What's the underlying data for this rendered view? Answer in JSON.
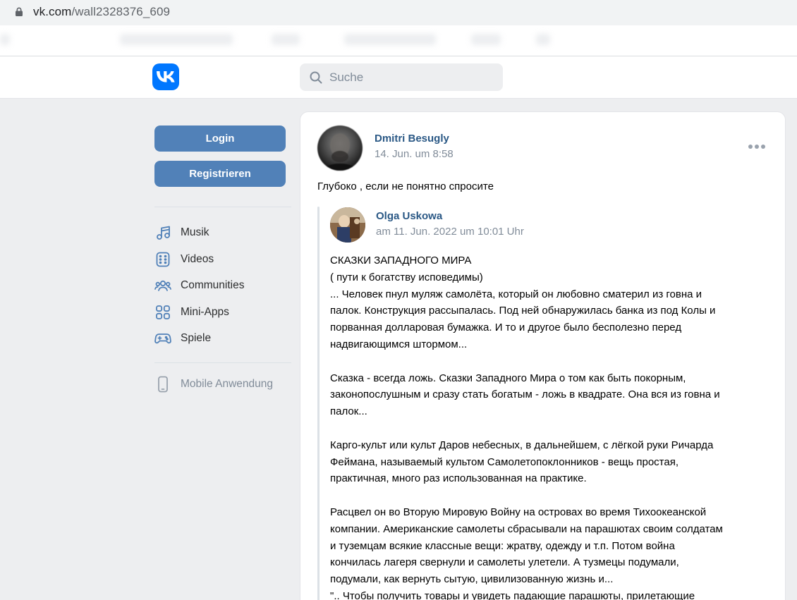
{
  "browser": {
    "url_host": "vk.com",
    "url_path": "/wall2328376_609"
  },
  "header": {
    "search_placeholder": "Suche"
  },
  "sidebar": {
    "login_label": "Login",
    "register_label": "Registrieren",
    "items": [
      {
        "label": "Musik",
        "icon": "music-icon"
      },
      {
        "label": "Videos",
        "icon": "videos-icon"
      },
      {
        "label": "Communities",
        "icon": "communities-icon"
      },
      {
        "label": "Mini-Apps",
        "icon": "mini-apps-icon"
      },
      {
        "label": "Spiele",
        "icon": "games-icon"
      }
    ],
    "mobile_label": "Mobile Anwendung"
  },
  "post": {
    "author": "Dmitri Besugly",
    "date": "14. Jun. um 8:58",
    "text": "Глубоко , если не понятно спросите",
    "repost": {
      "author": "Olga Uskowa",
      "date": "am 11. Jun. 2022 um 10:01 Uhr",
      "paragraphs": [
        "СКАЗКИ ЗАПАДНОГО МИРА\n( пути к богатству исповедимы)\n... Человек пнул муляж самолёта, который он любовно сматерил из говна и\nпалок. Конструкция рассыпалась. Под ней обнаружилась банка из под Колы и\nпорванная долларовая бумажка. И то и другое было бесполезно перед\nнадвигающимся штормом...",
        "Сказка - всегда ложь. Сказки Западного Мира о том как быть покорным,\nзаконопослушным и сразу стать богатым - ложь в квадрате. Она вся из говна и\nпалок...",
        "Карго-культ или культ Даров небесных, в дальнейшем, с лёгкой руки Ричарда\nФеймана, называемый культом Самолетопоклонников - вещь простая,\nпрактичная, много раз использованная на практике.",
        "Расцвел он во Вторую Мировую Войну на островах во время Тихоокеанской\nкомпании. Американские самолеты сбрасывали на парашютах своим солдатам\nи туземцам всякие классные вещи: жратву, одежду и т.п. Потом война\nкончилась лагеря свернули и самолеты улетели. А тузмецы подумали,\nподумали, как вернуть сытую, цивилизованную жизнь и...\n\".. Чтобы получить товары и увидеть падающие парашюты, прилетающие"
      ]
    }
  },
  "colors": {
    "vk_blue": "#0077ff",
    "button_blue": "#5181b8",
    "link_blue": "#2a5885",
    "muted": "#818c99"
  }
}
